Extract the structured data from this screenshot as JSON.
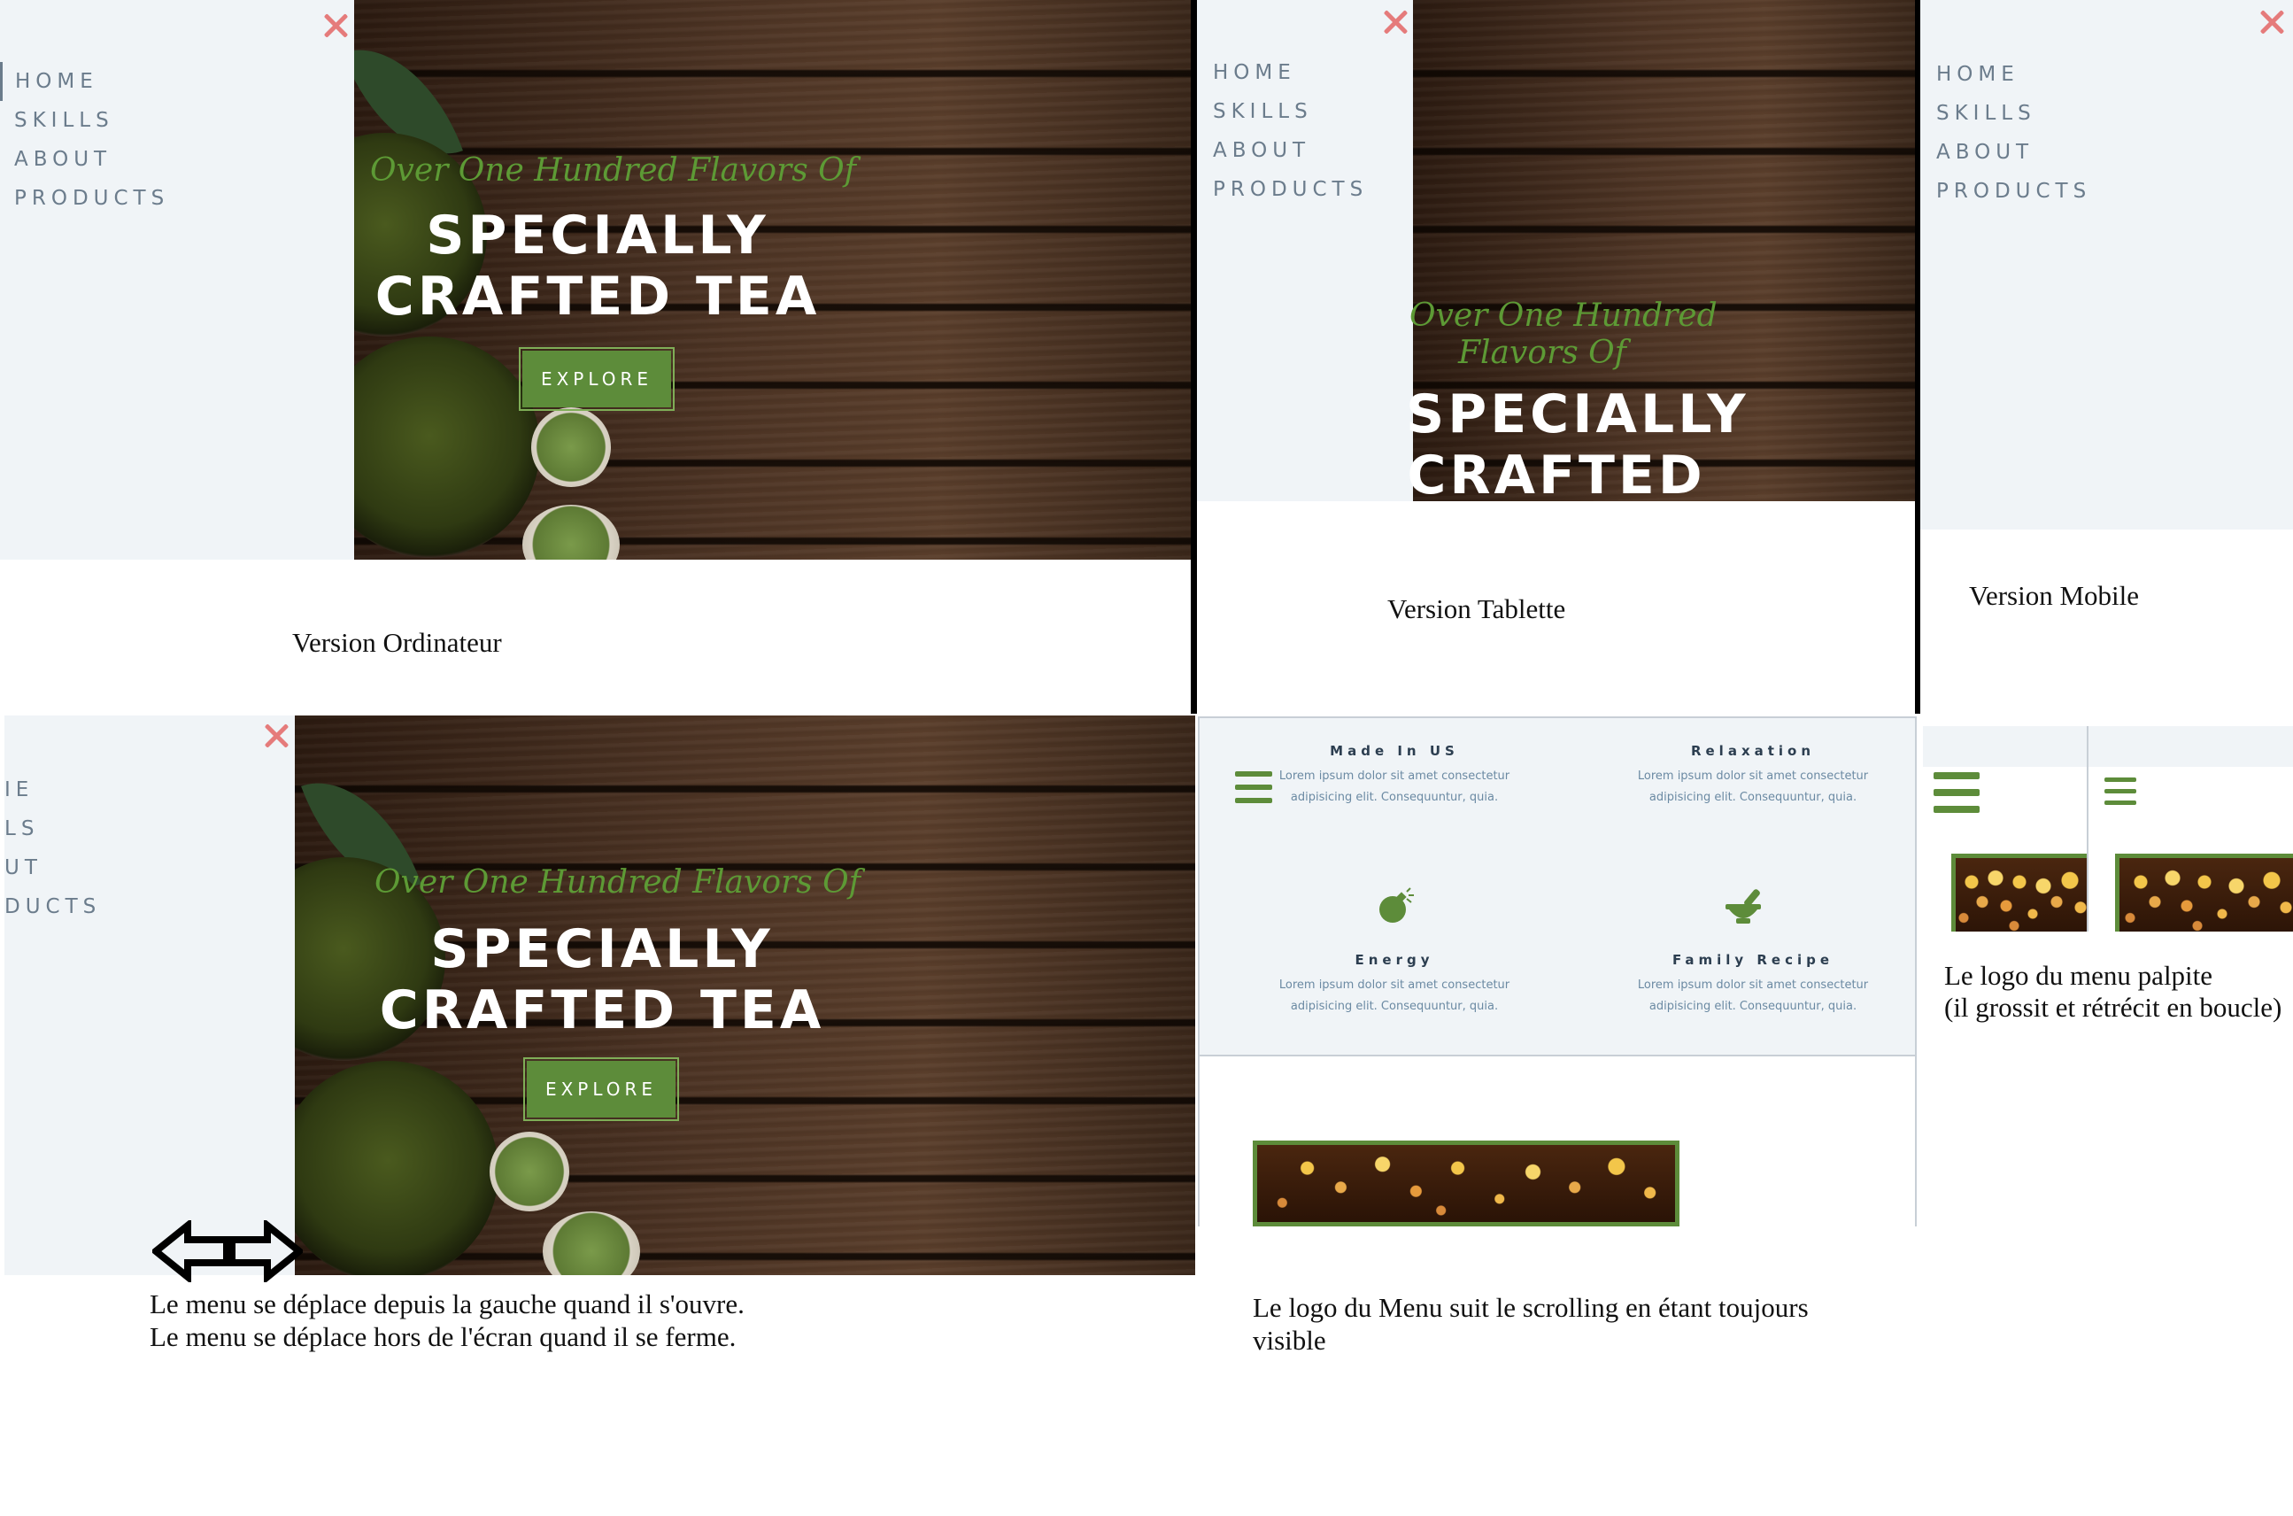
{
  "menu": {
    "items": [
      "HOME",
      "SKILLS",
      "ABOUT",
      "PRODUCTS"
    ],
    "items_cropped": [
      "IE",
      "LS",
      "UT",
      "DUCTS"
    ]
  },
  "hero": {
    "subtitle": "Over One Hundred Flavors Of",
    "subtitle_line1": "Over One Hundred",
    "subtitle_line2": "Flavors Of",
    "title_line1": "SPECIALLY",
    "title_line2": "CRAFTED TEA",
    "title_line2_tablet": "CRAFTED",
    "button": "EXPLORE"
  },
  "features": [
    {
      "title": "Made In US",
      "text_line1": "Lorem ipsum dolor sit amet consectetur",
      "text_line2": "adipisicing elit. Consequuntur, quia.",
      "icon": "none"
    },
    {
      "title": "Relaxation",
      "text_line1": "Lorem ipsum dolor sit amet consectetur",
      "text_line2": "adipisicing elit. Consequuntur, quia.",
      "icon": "none"
    },
    {
      "title": "Energy",
      "text_line1": "Lorem ipsum dolor sit amet consectetur",
      "text_line2": "adipisicing elit. Consequuntur, quia.",
      "icon": "bomb-icon"
    },
    {
      "title": "Family Recipe",
      "text_line1": "Lorem ipsum dolor sit amet consectetur",
      "text_line2": "adipisicing elit. Consequuntur, quia.",
      "icon": "mortar-pestle-icon"
    }
  ],
  "captions": {
    "desktop": "Version Ordinateur",
    "tablet": "Version Tablette",
    "mobile": "Version Mobile",
    "slide_line1": "Le menu se déplace depuis la gauche quand il s'ouvre.",
    "slide_line2": "Le menu se déplace hors de l'écran quand il se ferme.",
    "sticky_line1": "Le logo du Menu suit le scrolling en étant toujours",
    "sticky_line2": "visible",
    "pulse_line1": "Le logo du menu palpite",
    "pulse_line2": "(il grossit et rétrécit en boucle)"
  },
  "colors": {
    "menu_bg": "#f0f4f7",
    "menu_text": "#6b7c8c",
    "accent_green": "#5d8c3a",
    "close_red": "#e57b7b",
    "subtitle_green": "#5d9a35"
  }
}
